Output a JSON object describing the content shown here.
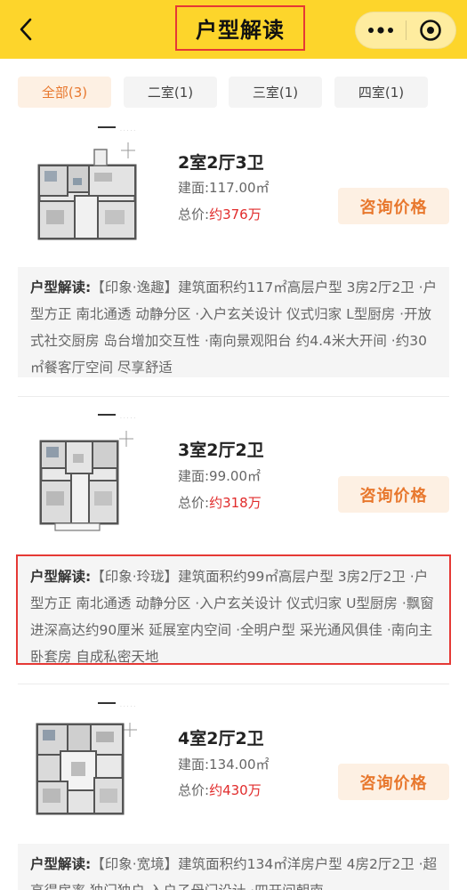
{
  "header": {
    "title": "户型解读",
    "back_icon": "chevron-left-icon",
    "more_icon": "more-dots-icon",
    "close_icon": "target-close-icon",
    "bg_color": "#fdd52b"
  },
  "tabs": [
    {
      "label": "全部(3)",
      "active": true
    },
    {
      "label": "二室(1)",
      "active": false
    },
    {
      "label": "三室(1)",
      "active": false
    },
    {
      "label": "四室(1)",
      "active": false
    }
  ],
  "colors": {
    "accent": "#e8782e",
    "price": "#e12b2b",
    "accent_bg": "#fdf0e3"
  },
  "units": [
    {
      "title": "2室2厅3卫",
      "area": "建面:117.00㎡",
      "price_label": "总价:",
      "price_value": "约376万",
      "consult_label": "咨询价格",
      "desc_label": "户型解读:",
      "desc_text": "【印象·逸趣】建筑面积约117㎡高层户型 3房2厅2卫 ·户型方正 南北通透 动静分区 ·入户玄关设计 仪式归家 L型厨房 ·开放式社交厨房 岛台增加交互性 ·南向景观阳台 约4.4米大开间 ·约30㎡餐客厅空间 尽享舒适"
    },
    {
      "title": "3室2厅2卫",
      "area": "建面:99.00㎡",
      "price_label": "总价:",
      "price_value": "约318万",
      "consult_label": "咨询价格",
      "desc_label": "户型解读:",
      "desc_text": "【印象·玲珑】建筑面积约99㎡高层户型 3房2厅2卫 ·户型方正 南北通透 动静分区 ·入户玄关设计 仪式归家 U型厨房 ·飘窗进深高达约90厘米 延展室内空间 ·全明户型 采光通风俱佳 ·南向主卧套房 自成私密天地"
    },
    {
      "title": "4室2厅2卫",
      "area": "建面:134.00㎡",
      "price_label": "总价:",
      "price_value": "约430万",
      "consult_label": "咨询价格",
      "desc_label": "户型解读:",
      "desc_text": "【印象·宽境】建筑面积约134㎡洋房户型 4房2厅2卫 ·超高得房率 独门独户 入户子母门设计 ·四开间朝南"
    }
  ]
}
